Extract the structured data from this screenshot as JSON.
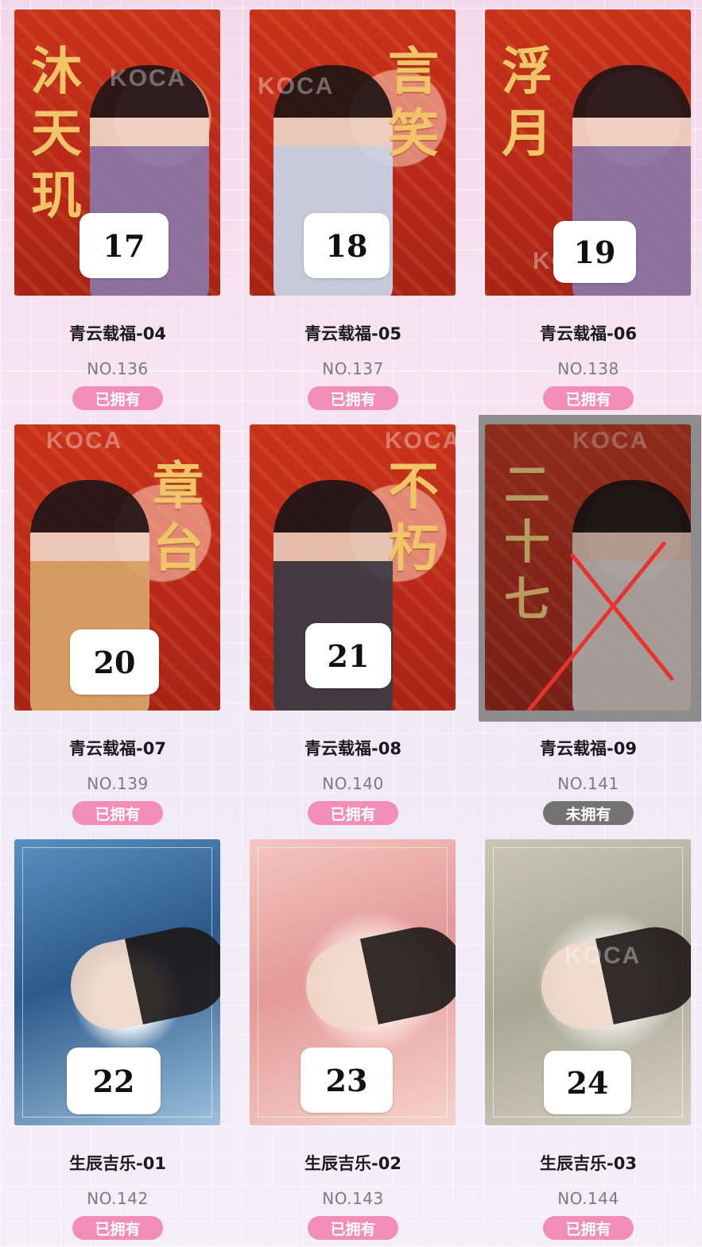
{
  "items": [
    {
      "calligraphy": "沐天玑",
      "number": "17",
      "title": "青云载福-04",
      "no": "NO.136",
      "status": "已拥有",
      "owned": true
    },
    {
      "calligraphy": "言笑",
      "number": "18",
      "title": "青云载福-05",
      "no": "NO.137",
      "status": "已拥有",
      "owned": true
    },
    {
      "calligraphy": "浮月",
      "number": "19",
      "title": "青云载福-06",
      "no": "NO.138",
      "status": "已拥有",
      "owned": true
    },
    {
      "calligraphy": "章台",
      "number": "20",
      "title": "青云载福-07",
      "no": "NO.139",
      "status": "已拥有",
      "owned": true
    },
    {
      "calligraphy": "不朽",
      "number": "21",
      "title": "青云载福-08",
      "no": "NO.140",
      "status": "已拥有",
      "owned": true
    },
    {
      "calligraphy": "二十七",
      "title": "青云载福-09",
      "no": "NO.141",
      "status": "未拥有",
      "owned": false
    },
    {
      "number": "22",
      "title": "生辰吉乐-01",
      "no": "NO.142",
      "status": "已拥有",
      "owned": true
    },
    {
      "number": "23",
      "title": "生辰吉乐-02",
      "no": "NO.143",
      "status": "已拥有",
      "owned": true
    },
    {
      "number": "24",
      "title": "生辰吉乐-03",
      "no": "NO.144",
      "status": "已拥有",
      "owned": true
    }
  ],
  "watermark": "KOCA",
  "colors": {
    "owned_badge": "#f18db6",
    "not_owned_badge": "#737373",
    "cross": "#e8322f"
  }
}
